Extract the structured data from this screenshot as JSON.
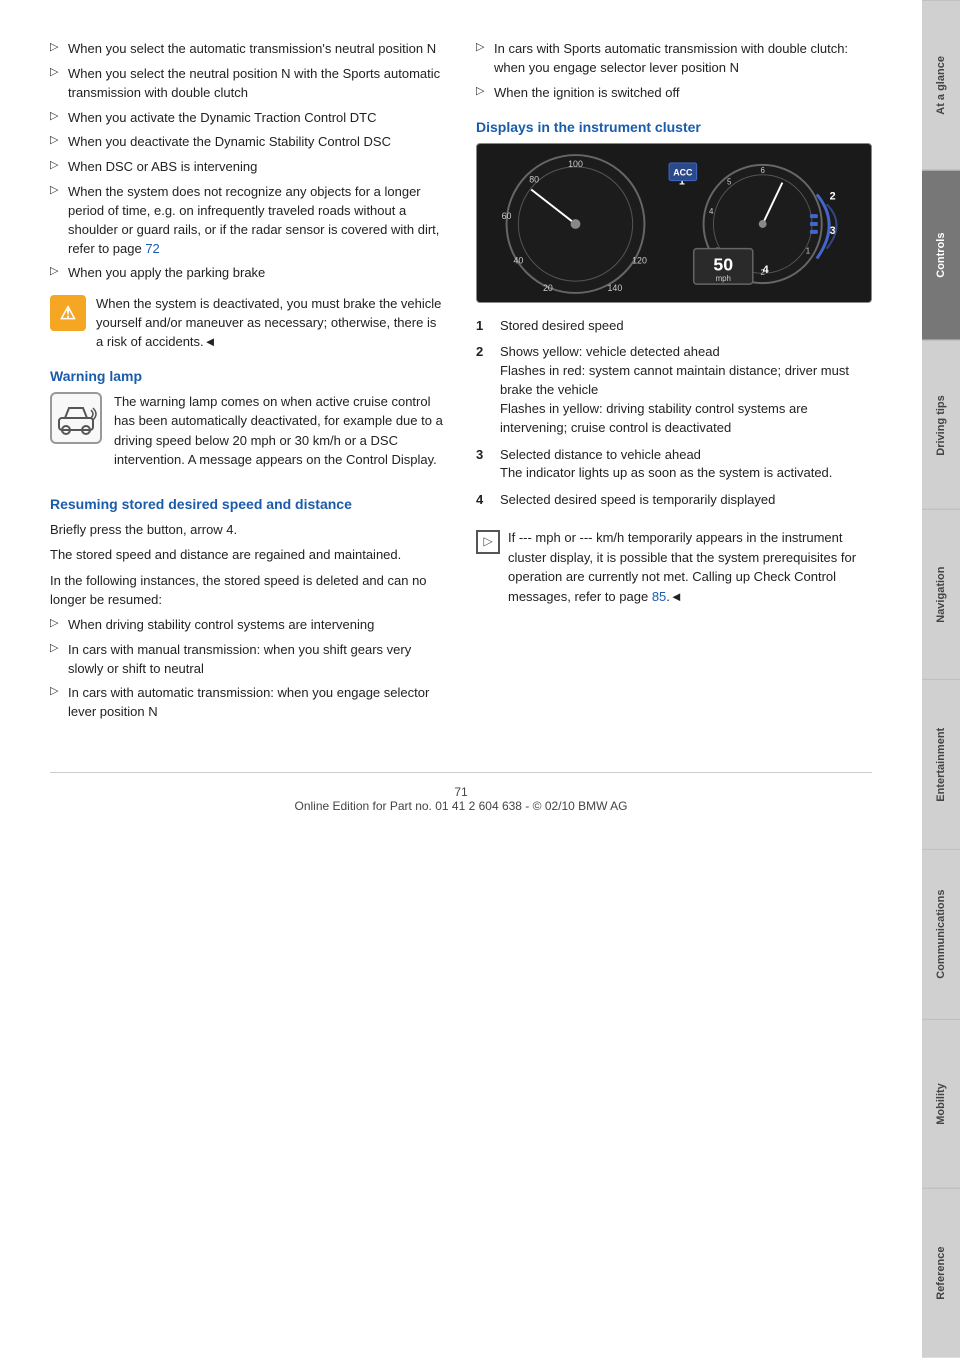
{
  "sidebar": {
    "tabs": [
      {
        "label": "At a glance",
        "active": false
      },
      {
        "label": "Controls",
        "active": true
      },
      {
        "label": "Driving tips",
        "active": false
      },
      {
        "label": "Navigation",
        "active": false
      },
      {
        "label": "Entertainment",
        "active": false
      },
      {
        "label": "Communications",
        "active": false
      },
      {
        "label": "Mobility",
        "active": false
      },
      {
        "label": "Reference",
        "active": false
      }
    ]
  },
  "left_column": {
    "bullet_items": [
      "When you select the automatic transmission's neutral position N",
      "When you select the neutral position N with the Sports automatic transmission with double clutch",
      "When you activate the Dynamic Traction Control DTC",
      "When you deactivate the Dynamic Stability Control DSC",
      "When DSC or ABS is intervening",
      "When the system does not recognize any objects for a longer period of time, e.g. on infrequently traveled roads without a shoulder or guard rails, or if the radar sensor is covered with dirt, refer to page 72",
      "When you apply the parking brake"
    ],
    "warning_text": "When the system is deactivated, you must brake the vehicle yourself and/or maneuver as necessary; otherwise, there is a risk of accidents.◄",
    "warning_lamp_heading": "Warning lamp",
    "warning_lamp_text": "The warning lamp comes on when active cruise control has been automatically deactivated, for example due to a driving speed below 20 mph or 30 km/h or a DSC intervention. A message appears on the Control Display.",
    "resuming_heading": "Resuming stored desired speed and distance",
    "resuming_para1": "Briefly press the button, arrow 4.",
    "resuming_para2": "The stored speed and distance are regained and maintained.",
    "resuming_para3": "In the following instances, the stored speed is deleted and can no longer be resumed:",
    "resuming_bullets": [
      "When driving stability control systems are intervening",
      "In cars with manual transmission: when you shift gears very slowly or shift to neutral",
      "In cars with automatic transmission: when you engage selector lever position N"
    ]
  },
  "right_column": {
    "right_bullets": [
      "In cars with Sports automatic transmission with double clutch: when you engage selector lever position N",
      "When the ignition is switched off"
    ],
    "cluster_heading": "Displays in the instrument cluster",
    "cluster_numbers": [
      "1",
      "2",
      "3",
      "4"
    ],
    "cluster_speed": "50",
    "cluster_speed_unit": "mph",
    "annotations": [
      {
        "num": "1",
        "text": "Stored desired speed"
      },
      {
        "num": "2",
        "text": "Shows yellow: vehicle detected ahead\nFlashes in red: system cannot maintain distance; driver must brake the vehicle\nFlashes in yellow: driving stability control systems are intervening; cruise control is deactivated"
      },
      {
        "num": "3",
        "text": "Selected distance to vehicle ahead\nThe indicator lights up as soon as the system is activated."
      },
      {
        "num": "4",
        "text": "Selected desired speed is temporarily displayed"
      }
    ],
    "info_text": "If --- mph or --- km/h temporarily appears in the instrument cluster display, it is possible that the system prerequisites for operation are currently not met. Calling up Check Control messages, refer to page 85.◄",
    "ref_page": "85"
  },
  "footer": {
    "page_number": "71",
    "copyright": "Online Edition for Part no. 01 41 2 604 638 - © 02/10 BMW AG"
  }
}
